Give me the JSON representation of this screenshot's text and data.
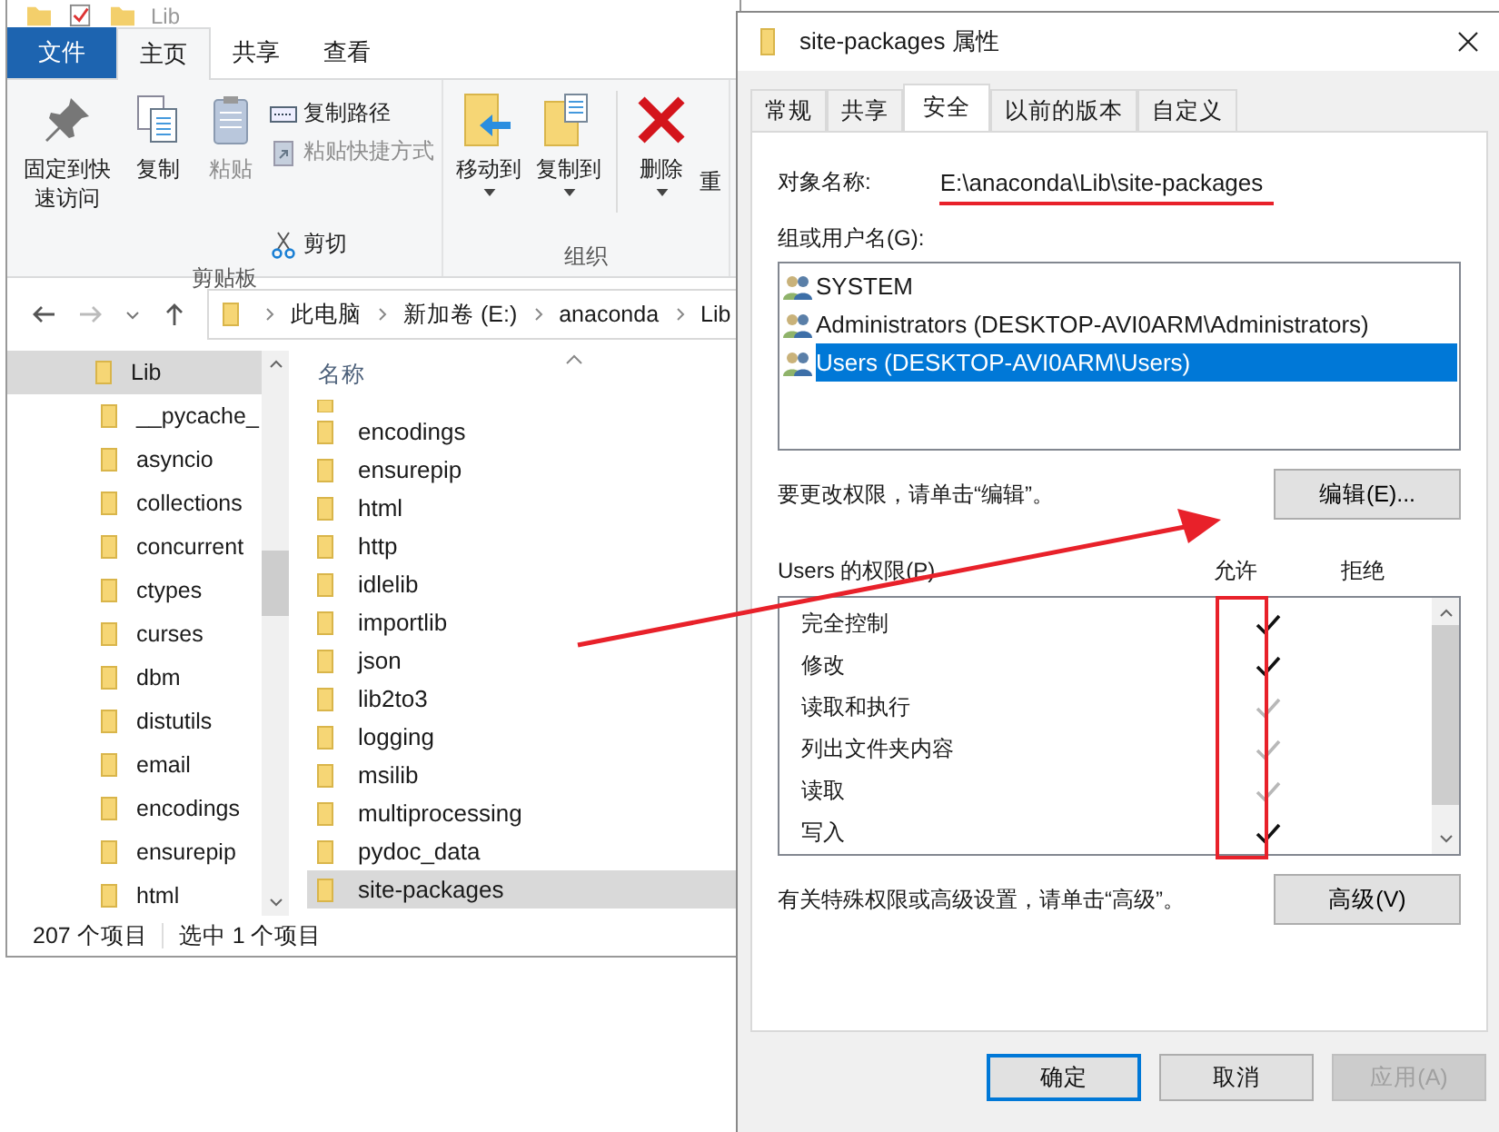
{
  "explorer": {
    "title": "Lib",
    "ribbon_tabs": [
      {
        "label": "文件",
        "kind": "file",
        "selected": false
      },
      {
        "label": "主页",
        "kind": "tab",
        "selected": true
      },
      {
        "label": "共享",
        "kind": "tab",
        "selected": false
      },
      {
        "label": "查看",
        "kind": "tab",
        "selected": false
      }
    ],
    "clipboard_group": {
      "label": "剪贴板",
      "pin": "固定到快速访问",
      "copy": "复制",
      "paste": "粘贴",
      "copy_path": "复制路径",
      "paste_shortcut": "粘贴快捷方式",
      "cut": "剪切"
    },
    "organize_group": {
      "label": "组织",
      "move_to": "移动到",
      "copy_to": "复制到",
      "delete": "删除",
      "cut_off": "重"
    },
    "address": [
      "此电脑",
      "新加卷 (E:)",
      "anaconda",
      "Lib"
    ],
    "nav_tree": [
      {
        "label": "Lib",
        "selected": true,
        "children": [
          {
            "label": "__pycache_"
          },
          {
            "label": "asyncio"
          },
          {
            "label": "collections"
          },
          {
            "label": "concurrent"
          },
          {
            "label": "ctypes"
          },
          {
            "label": "curses"
          },
          {
            "label": "dbm"
          },
          {
            "label": "distutils"
          },
          {
            "label": "email"
          },
          {
            "label": "encodings"
          },
          {
            "label": "ensurepip"
          },
          {
            "label": "html"
          }
        ]
      }
    ],
    "name_column": "名称",
    "files": [
      {
        "name": "encodings",
        "selected": false
      },
      {
        "name": "ensurepip",
        "selected": false
      },
      {
        "name": "html",
        "selected": false
      },
      {
        "name": "http",
        "selected": false
      },
      {
        "name": "idlelib",
        "selected": false
      },
      {
        "name": "importlib",
        "selected": false
      },
      {
        "name": "json",
        "selected": false
      },
      {
        "name": "lib2to3",
        "selected": false
      },
      {
        "name": "logging",
        "selected": false
      },
      {
        "name": "msilib",
        "selected": false
      },
      {
        "name": "multiprocessing",
        "selected": false
      },
      {
        "name": "pydoc_data",
        "selected": false
      },
      {
        "name": "site-packages",
        "selected": true
      }
    ],
    "status_bar": {
      "count": "207 个项目",
      "selection": "选中 1 个项目"
    }
  },
  "dialog": {
    "title": "site-packages 属性",
    "tabs": [
      {
        "label": "常规",
        "selected": false
      },
      {
        "label": "共享",
        "selected": false
      },
      {
        "label": "安全",
        "selected": true
      },
      {
        "label": "以前的版本",
        "selected": false
      },
      {
        "label": "自定义",
        "selected": false
      }
    ],
    "object_label": "对象名称:",
    "object_name": "E:\\anaconda\\Lib\\site-packages",
    "groups_label": "组或用户名(G):",
    "groups": [
      {
        "name": "SYSTEM",
        "selected": false
      },
      {
        "name": "Administrators (DESKTOP-AVI0ARM\\Administrators)",
        "selected": false
      },
      {
        "name": "Users (DESKTOP-AVI0ARM\\Users)",
        "selected": true
      }
    ],
    "edit_hint": "要更改权限，请单击“编辑”。",
    "edit_button": "编辑(E)...",
    "permissions_label": "Users 的权限(P)",
    "allow_header": "允许",
    "deny_header": "拒绝",
    "permissions": [
      {
        "name": "完全控制",
        "allowed": true,
        "inherited": false
      },
      {
        "name": "修改",
        "allowed": true,
        "inherited": false
      },
      {
        "name": "读取和执行",
        "allowed": true,
        "inherited": true
      },
      {
        "name": "列出文件夹内容",
        "allowed": true,
        "inherited": true
      },
      {
        "name": "读取",
        "allowed": true,
        "inherited": true
      },
      {
        "name": "写入",
        "allowed": true,
        "inherited": false
      }
    ],
    "advanced_hint": "有关特殊权限或高级设置，请单击“高级”。",
    "advanced_button": "高级(V)",
    "buttons": [
      {
        "label": "确定",
        "kind": "default",
        "disabled": false
      },
      {
        "label": "取消",
        "kind": "normal",
        "disabled": false
      },
      {
        "label": "应用(A)",
        "kind": "normal",
        "disabled": true
      }
    ]
  }
}
